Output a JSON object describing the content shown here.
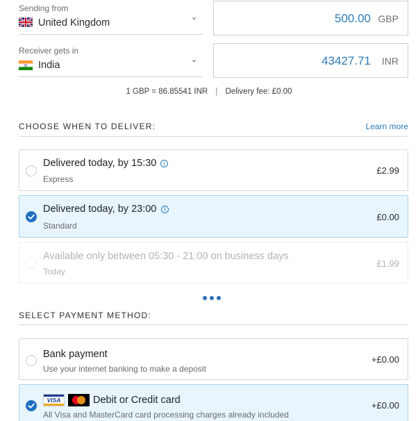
{
  "sending": {
    "label": "Sending from",
    "country": "United Kingdom",
    "amount": "500.00",
    "currency": "GBP"
  },
  "receiving": {
    "label": "Receiver gets in",
    "country": "India",
    "amount": "43427.71",
    "currency": "INR"
  },
  "rate_line": {
    "rate": "1 GBP = 86.85541 INR",
    "separator": "|",
    "fee": "Delivery fee: £0.00"
  },
  "delivery": {
    "section_title": "CHOOSE WHEN TO DELIVER:",
    "learn_more": "Learn more",
    "options": [
      {
        "title": "Delivered today, by 15:30",
        "subtitle": "Express",
        "price": "£2.99",
        "selected": false,
        "disabled": false
      },
      {
        "title": "Delivered today, by 23:00",
        "subtitle": "Standard",
        "price": "£0.00",
        "selected": true,
        "disabled": false
      },
      {
        "title": "Available only between 05:30 - 21:00 on business days",
        "subtitle": "Today",
        "price": "£1.99",
        "selected": false,
        "disabled": true
      }
    ],
    "more_icon": "more-dots-icon"
  },
  "payment": {
    "section_title": "SELECT PAYMENT METHOD:",
    "options": [
      {
        "title": "Bank payment",
        "subtitle": "Use your internet banking to make a deposit",
        "price": "+£0.00",
        "selected": false
      },
      {
        "title": "Debit or Credit card",
        "subtitle": "All Visa and MasterCard card processing charges already included",
        "price": "+£0.00",
        "selected": true,
        "logos": [
          "visa-logo",
          "mastercard-logo"
        ],
        "visa_text": "VISA"
      }
    ]
  },
  "colors": {
    "accent_blue": "#2e7cb7",
    "selected_bg": "#e8f5fc",
    "check_blue": "#1f6fbf"
  }
}
